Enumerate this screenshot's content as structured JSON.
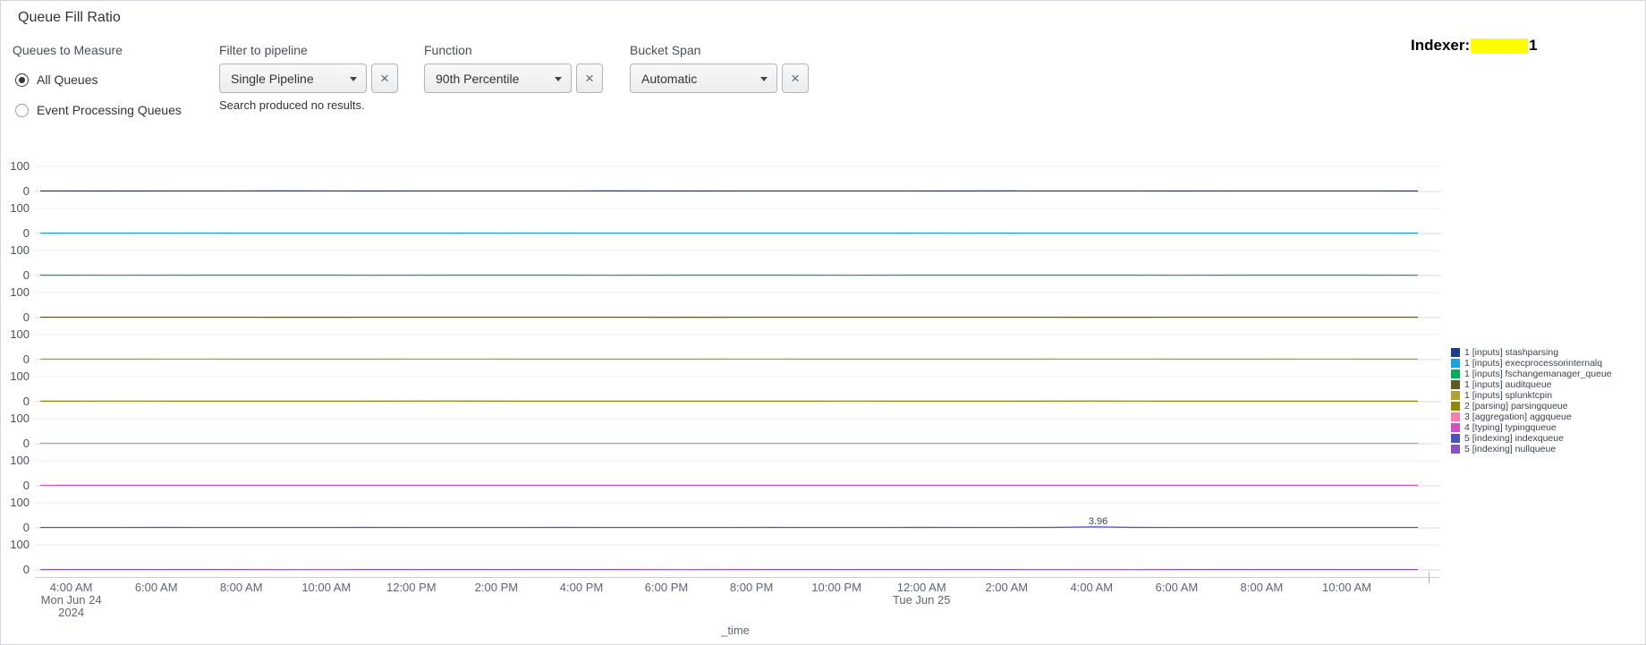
{
  "page": {
    "title": "Queue Fill Ratio"
  },
  "icons": {
    "close": "×"
  },
  "controls": {
    "queues_to_measure": {
      "label": "Queues to Measure",
      "options": [
        {
          "label": "All Queues",
          "selected": true
        },
        {
          "label": "Event Processing Queues",
          "selected": false
        }
      ]
    },
    "filter_to_pipeline": {
      "label": "Filter to pipeline",
      "value": "Single Pipeline",
      "message": "Search produced no results."
    },
    "function": {
      "label": "Function",
      "value": "90th Percentile"
    },
    "bucket_span": {
      "label": "Bucket Span",
      "value": "Automatic"
    }
  },
  "header_right": {
    "label": "Indexer:",
    "redacted": true,
    "highlight_color": "#ffff00",
    "suffix": "1"
  },
  "chart_data": {
    "type": "line",
    "layout": "small_multiples_stacked",
    "title": "Queue Fill Ratio",
    "xlabel": "_time",
    "ylim": [
      0,
      100
    ],
    "panel_y_ticks": [
      "100",
      "0"
    ],
    "grid": "horizontal-only",
    "legend_position": "right",
    "x_ticks": [
      {
        "label": "4:00 AM",
        "sub": [
          "Mon Jun 24",
          "2024"
        ]
      },
      {
        "label": "6:00 AM"
      },
      {
        "label": "8:00 AM"
      },
      {
        "label": "10:00 AM"
      },
      {
        "label": "12:00 PM"
      },
      {
        "label": "2:00 PM"
      },
      {
        "label": "4:00 PM"
      },
      {
        "label": "6:00 PM"
      },
      {
        "label": "8:00 PM"
      },
      {
        "label": "10:00 PM"
      },
      {
        "label": "12:00 AM",
        "sub": [
          "Tue Jun 25"
        ]
      },
      {
        "label": "2:00 AM"
      },
      {
        "label": "4:00 AM"
      },
      {
        "label": "6:00 AM"
      },
      {
        "label": "8:00 AM"
      },
      {
        "label": "10:00 AM"
      }
    ],
    "annotation": {
      "text": "3.96",
      "series_index": 8,
      "point_index": 26,
      "x_tick": "4:00 AM",
      "value": 3.96
    },
    "series": [
      {
        "name": "1 [inputs] stashparsing",
        "color": "#1a3e8f",
        "values": [
          2,
          1.9,
          2,
          2.1,
          1.9,
          2,
          2,
          2.1,
          1.9,
          2,
          2,
          1.9,
          2.1,
          2,
          1.9,
          2,
          2,
          1.9
        ]
      },
      {
        "name": "1 [inputs] execprocessorinternalq",
        "color": "#18a4dc",
        "values": [
          1.4,
          1.4,
          1.5,
          1.3,
          1.4,
          1.4,
          1.5,
          1.4,
          1.3,
          1.4,
          1.4,
          1.5,
          1.4,
          1.3,
          1.4,
          1.4,
          1.3,
          1.4
        ]
      },
      {
        "name": "1 [inputs] fschangemanager_queue",
        "color": "#00ae57",
        "values": [
          1.7,
          1.6,
          1.7,
          1.8,
          1.6,
          1.7,
          1.7,
          1.6,
          1.8,
          1.7,
          1.6,
          1.7,
          1.7,
          1.8,
          1.6,
          1.7,
          1.7,
          1.6
        ]
      },
      {
        "name": "1 [inputs] auditqueue",
        "color": "#5e5a20",
        "values": [
          1.5,
          1.5,
          1.6,
          1.4,
          1.5,
          1.5,
          1.6,
          1.5,
          1.4,
          1.5,
          1.5,
          1.6,
          1.5,
          1.4,
          1.5,
          1.5,
          1.6,
          1.5
        ]
      },
      {
        "name": "1 [inputs] splunktcpin",
        "color": "#b2a02f",
        "values": [
          2.3,
          2.1,
          2.4,
          2.2,
          2.3,
          2.5,
          2.2,
          2.3,
          2.1,
          2.4,
          2.2,
          2.3,
          2.2,
          2.5,
          2.3,
          2.2,
          2.4,
          2.2
        ]
      },
      {
        "name": "2 [parsing] parsingqueue",
        "color": "#8c8a00",
        "values": [
          2.2,
          2.4,
          2.1,
          2.3,
          2.2,
          2.6,
          2.2,
          2.1,
          2.3,
          2.2,
          2.4,
          2.2,
          2.1,
          2.8,
          2.3,
          2.2,
          2.1,
          2.2
        ]
      },
      {
        "name": "3 [aggregation] aggqueue",
        "color": "#fb7daf",
        "values": [
          1.8,
          1.7,
          1.9,
          1.8,
          1.7,
          1.8,
          1.9,
          1.8,
          1.7,
          1.8,
          1.8,
          1.9,
          1.7,
          1.8,
          1.8,
          1.7,
          1.9,
          1.8
        ]
      },
      {
        "name": "4 [typing] typingqueue",
        "color": "#d14fc7",
        "values": [
          1.8,
          1.8,
          1.7,
          1.9,
          1.8,
          1.8,
          1.7,
          1.8,
          1.9,
          1.8,
          1.8,
          1.7,
          1.8,
          1.9,
          1.8,
          1.8,
          1.7,
          1.8
        ]
      },
      {
        "name": "5 [indexing] indexqueue",
        "color": "#4d52c2",
        "values": [
          1.6,
          1.5,
          1.6,
          1.7,
          1.5,
          1.6,
          1.6,
          1.5,
          1.7,
          1.6,
          1.5,
          1.6,
          1.6,
          1.7,
          1.5,
          1.6,
          1.6,
          1.5,
          1.7,
          1.6,
          1.5,
          1.6,
          1.7,
          1.5,
          1.6,
          1.8,
          3.96,
          1.8,
          1.6,
          1.5,
          1.6,
          1.6,
          1.5,
          1.6,
          1.6
        ]
      },
      {
        "name": "5 [indexing] nullqueue",
        "color": "#8a52c2",
        "values": [
          1.2,
          1.2,
          1.3,
          1.1,
          1.2,
          1.2,
          1.3,
          1.2,
          1.1,
          1.2,
          1.2,
          1.3,
          1.2,
          1.1,
          1.2,
          1.2,
          1.3,
          1.2
        ]
      }
    ]
  }
}
